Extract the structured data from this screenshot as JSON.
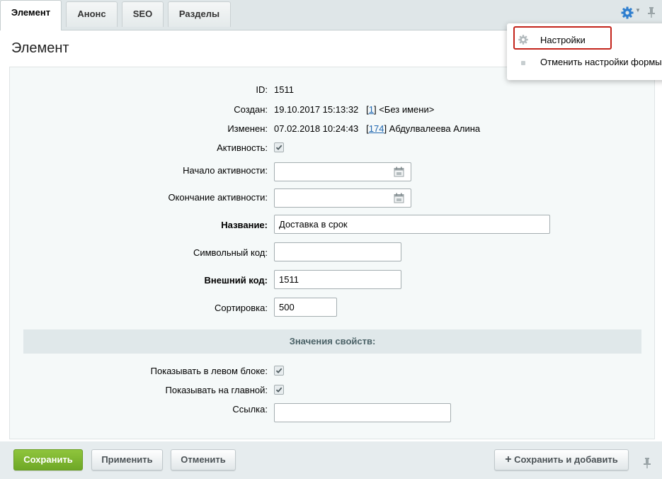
{
  "tabs": [
    {
      "label": "Элемент",
      "active": true
    },
    {
      "label": "Анонс"
    },
    {
      "label": "SEO"
    },
    {
      "label": "Разделы"
    }
  ],
  "panel_title": "Элемент",
  "settings_menu": {
    "items": [
      "Настройки",
      "Отменить настройки формы"
    ]
  },
  "form": {
    "id": {
      "label": "ID:",
      "value": "1511"
    },
    "created": {
      "label": "Создан:",
      "value": "19.10.2017 15:13:32",
      "user_prefix": "[",
      "user_id": "1",
      "user_suffix": "] <Без имени>"
    },
    "modified": {
      "label": "Изменен:",
      "value": "07.02.2018 10:24:43",
      "user_prefix": "[",
      "user_id": "174",
      "user_suffix": "] Абдулвалеева Алина"
    },
    "active": {
      "label": "Активность:",
      "checked": true
    },
    "active_from": {
      "label": "Начало активности:",
      "value": ""
    },
    "active_to": {
      "label": "Окончание активности:",
      "value": ""
    },
    "name": {
      "label": "Название:",
      "value": "Доставка в срок"
    },
    "code": {
      "label": "Символьный код:",
      "value": ""
    },
    "xml_id": {
      "label": "Внешний код:",
      "value": "1511"
    },
    "sort": {
      "label": "Сортировка:",
      "value": "500"
    },
    "properties_header": "Значения свойств:",
    "show_left": {
      "label": "Показывать в левом блоке:",
      "checked": true
    },
    "show_main": {
      "label": "Показывать на главной:",
      "checked": true
    },
    "link": {
      "label": "Ссылка:",
      "value": ""
    }
  },
  "buttons": {
    "save": "Сохранить",
    "apply": "Применить",
    "cancel": "Отменить",
    "save_add": "Сохранить и добавить"
  },
  "colors": {
    "accent_green": "#7cb52f",
    "highlight_red": "#c3241b",
    "link_blue": "#2067b0",
    "gear_blue": "#2f7fcf"
  },
  "icons": [
    "settings-gear-icon",
    "pin-icon",
    "calendar-icon",
    "checkbox-check-icon",
    "plus-icon"
  ]
}
